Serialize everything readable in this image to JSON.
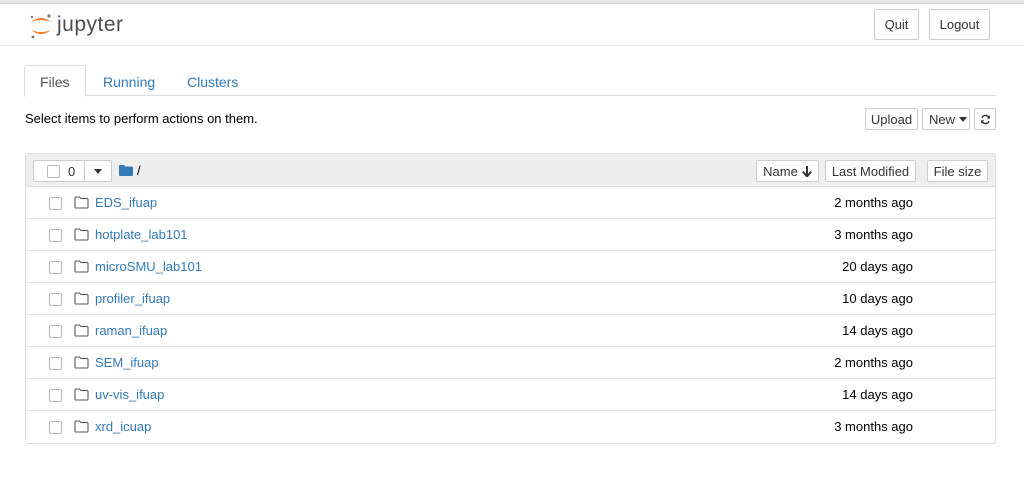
{
  "header": {
    "logo_text": "jupyter",
    "quit_label": "Quit",
    "logout_label": "Logout"
  },
  "tabs": [
    {
      "label": "Files",
      "active": true
    },
    {
      "label": "Running",
      "active": false
    },
    {
      "label": "Clusters",
      "active": false
    }
  ],
  "toolbar": {
    "instructions": "Select items to perform actions on them.",
    "upload_label": "Upload",
    "new_label": "New"
  },
  "list_header": {
    "selected_count": "0",
    "path": "/",
    "name_label": "Name",
    "last_modified_label": "Last Modified",
    "file_size_label": "File size"
  },
  "items": [
    {
      "name": "EDS_ifuap",
      "modified": "2 months ago"
    },
    {
      "name": "hotplate_lab101",
      "modified": "3 months ago"
    },
    {
      "name": "microSMU_lab101",
      "modified": "20 days ago"
    },
    {
      "name": "profiler_ifuap",
      "modified": "10 days ago"
    },
    {
      "name": "raman_ifuap",
      "modified": "14 days ago"
    },
    {
      "name": "SEM_ifuap",
      "modified": "2 months ago"
    },
    {
      "name": "uv-vis_ifuap",
      "modified": "14 days ago"
    },
    {
      "name": "xrd_icuap",
      "modified": "3 months ago"
    }
  ],
  "colors": {
    "link": "#337ab7",
    "logo_orange": "#f37726",
    "header_bg": "#eeeeee"
  }
}
